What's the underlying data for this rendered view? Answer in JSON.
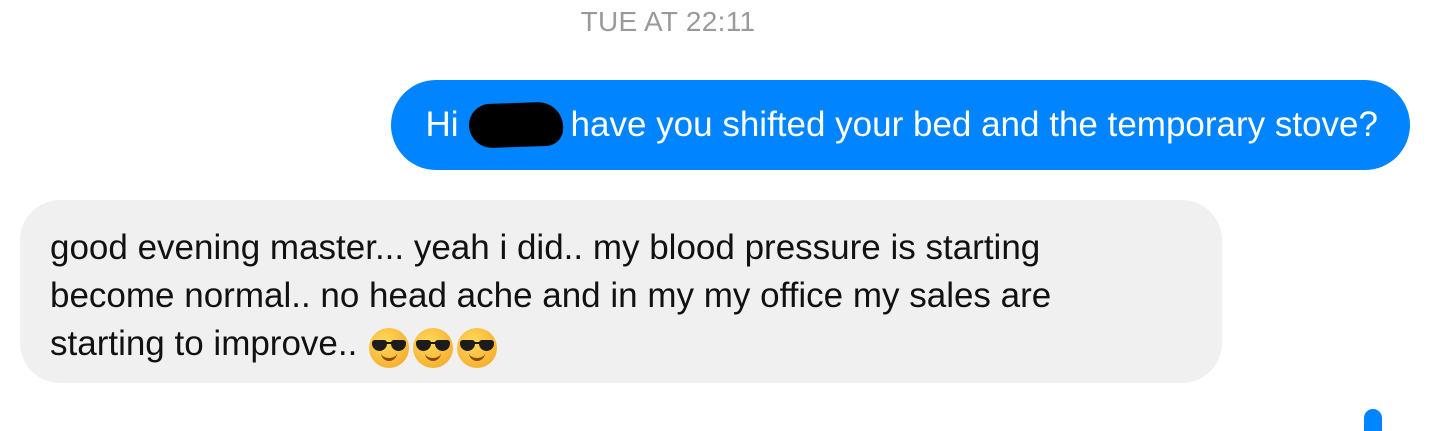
{
  "timestamp": "TUE AT 22:11",
  "messages": {
    "sent": {
      "greeting": "Hi",
      "text": "have you shifted your bed and the temporary stove?"
    },
    "received": {
      "line1": "good evening master... yeah i did.. my blood pressure is starting",
      "line2": "become normal.. no head ache and in my my office my sales are",
      "line3": "starting to improve..",
      "emojis": [
        "smiling-face-with-sunglasses",
        "smiling-face-with-sunglasses",
        "smiling-face-with-sunglasses"
      ]
    }
  },
  "colors": {
    "sent_bubble": "#0084ff",
    "received_bubble": "#f0f0f0",
    "timestamp": "#9a9a9a"
  }
}
